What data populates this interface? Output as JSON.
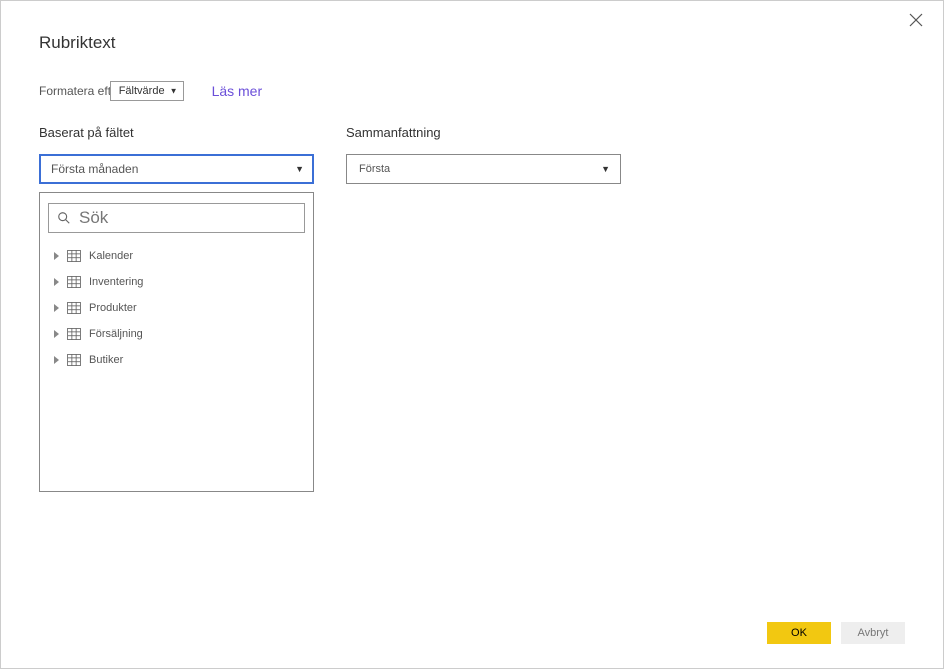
{
  "title": "Rubriktext",
  "format_row": {
    "label": "Formatera efter",
    "select_value": "Fältvärde",
    "learn_more": "Läs mer"
  },
  "left": {
    "label": "Baserat på fältet",
    "selected": "Första månaden",
    "search_placeholder": "Sök",
    "tables": [
      {
        "name": "Kalender"
      },
      {
        "name": "Inventering"
      },
      {
        "name": "Produkter"
      },
      {
        "name": "Försäljning"
      },
      {
        "name": "Butiker"
      }
    ]
  },
  "right": {
    "label": "Sammanfattning",
    "selected": "Första"
  },
  "footer": {
    "ok": "OK",
    "cancel": "Avbryt"
  }
}
